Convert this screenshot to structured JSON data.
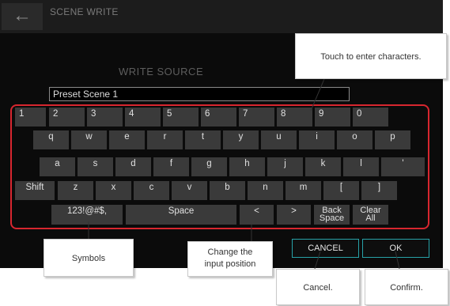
{
  "header": {
    "back_icon": "arrow-left-icon",
    "back_glyph": "←",
    "title": "SCENE WRITE"
  },
  "write_source": {
    "label": "WRITE SOURCE",
    "value": "Preset Scene 1"
  },
  "keyboard": {
    "rows": [
      [
        "1",
        "2",
        "3",
        "4",
        "5",
        "6",
        "7",
        "8",
        "9",
        "0"
      ],
      [
        "q",
        "w",
        "e",
        "r",
        "t",
        "y",
        "u",
        "i",
        "o",
        "p"
      ],
      [
        "a",
        "s",
        "d",
        "f",
        "g",
        "h",
        "j",
        "k",
        "l",
        "'"
      ],
      [
        "Shift",
        "z",
        "x",
        "c",
        "v",
        "b",
        "n",
        "m",
        "[",
        "]"
      ]
    ],
    "bottom": {
      "symbols": "123!@#$,",
      "space": "Space",
      "left": "<",
      "right": ">",
      "backspace": [
        "Back",
        "Space"
      ],
      "clear": [
        "Clear",
        "All"
      ]
    }
  },
  "buttons": {
    "cancel": "CANCEL",
    "ok": "OK"
  },
  "callouts": {
    "touch": "Touch to enter characters.",
    "symbols": "Symbols",
    "change": [
      "Change the",
      "input position"
    ],
    "cancel": "Cancel.",
    "confirm": "Confirm."
  },
  "colors": {
    "highlight": "#d7262f",
    "button_border": "#27a2a8",
    "key": "#3a3a3a"
  }
}
